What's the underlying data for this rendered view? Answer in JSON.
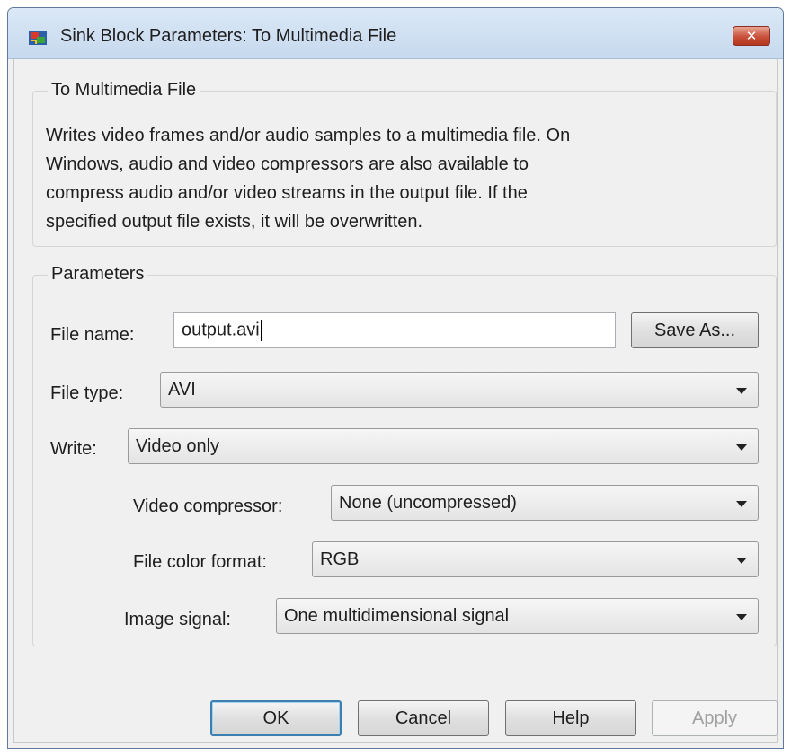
{
  "window": {
    "title": "Sink Block Parameters: To Multimedia File",
    "icon": "simulink-block-icon",
    "close_icon": "close-icon"
  },
  "description_group": {
    "title": "To Multimedia File",
    "lines": [
      "Writes video frames and/or audio samples to a multimedia file. On",
      "Windows, audio and video compressors are also available to",
      "compress audio and/or video streams in the output file. If the",
      "specified output file exists, it will be overwritten."
    ]
  },
  "parameters_group": {
    "title": "Parameters",
    "file_name_label": "File name:",
    "file_name_value": "output.avi",
    "save_as_label": "Save As...",
    "file_type_label": "File type:",
    "file_type_value": "AVI",
    "write_label": "Write:",
    "write_value": "Video only",
    "video_compressor_label": "Video compressor:",
    "video_compressor_value": "None (uncompressed)",
    "file_color_format_label": "File color format:",
    "file_color_format_value": "RGB",
    "image_signal_label": "Image signal:",
    "image_signal_value": "One multidimensional signal"
  },
  "buttons": {
    "ok": "OK",
    "cancel": "Cancel",
    "help": "Help",
    "apply": "Apply"
  },
  "colors": {
    "close_button": "#c9503a",
    "default_button_border": "#3c7fb1"
  }
}
